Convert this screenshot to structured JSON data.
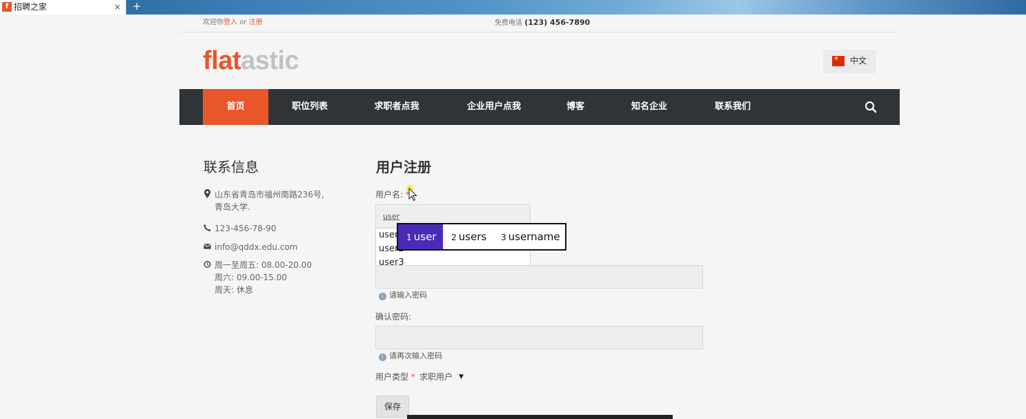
{
  "browser": {
    "tab_title": "招聘之家",
    "tab_favicon": "f",
    "close_symbol": "×",
    "new_tab_symbol": "+"
  },
  "topbar": {
    "welcome_prefix": "欢迎你",
    "login": "登入",
    "or": " or ",
    "register": "注册",
    "phone_label": "免费电话 ",
    "phone_number": "(123) 456-7890"
  },
  "logo": {
    "part1": "flat",
    "part2": "astic"
  },
  "language": {
    "label": "中文",
    "flag_icon": "china-flag-icon"
  },
  "nav": {
    "items": [
      "首页",
      "职位列表",
      "求职者点我",
      "企业用户点我",
      "博客",
      "知名企业",
      "联系我们"
    ],
    "active_index": 0
  },
  "sidebar": {
    "title": "联系信息",
    "address_line1": "山东省青岛市福州南路236号,",
    "address_line2": "青岛大学.",
    "phone": "123-456-78-90",
    "email": "info@qddx.edu.com",
    "hours_line1": "周一至周五: 08.00-20.00",
    "hours_line2": "周六: 09.00-15.00",
    "hours_line3": "周天: 休息"
  },
  "form": {
    "title": "用户注册",
    "username_label": "用户名: ",
    "username_required": "*",
    "username_value": "user",
    "autocomplete": [
      "user",
      "user2",
      "user3"
    ],
    "password_hint": "请输入密码",
    "confirm_label": "确认密码:",
    "confirm_hint": "请再次输入密码",
    "user_type_label": "用户类型 ",
    "user_type_required": "*",
    "user_type_value": "求职用户",
    "save_label": "保存"
  },
  "ime": {
    "candidates": [
      {
        "num": "1",
        "text": "user"
      },
      {
        "num": "2",
        "text": "users"
      },
      {
        "num": "3",
        "text": "username"
      }
    ],
    "selected_index": 0
  },
  "colors": {
    "accent": "#e8562a",
    "nav_bg": "#2f3439",
    "ime_selected": "#4a2bb7"
  }
}
